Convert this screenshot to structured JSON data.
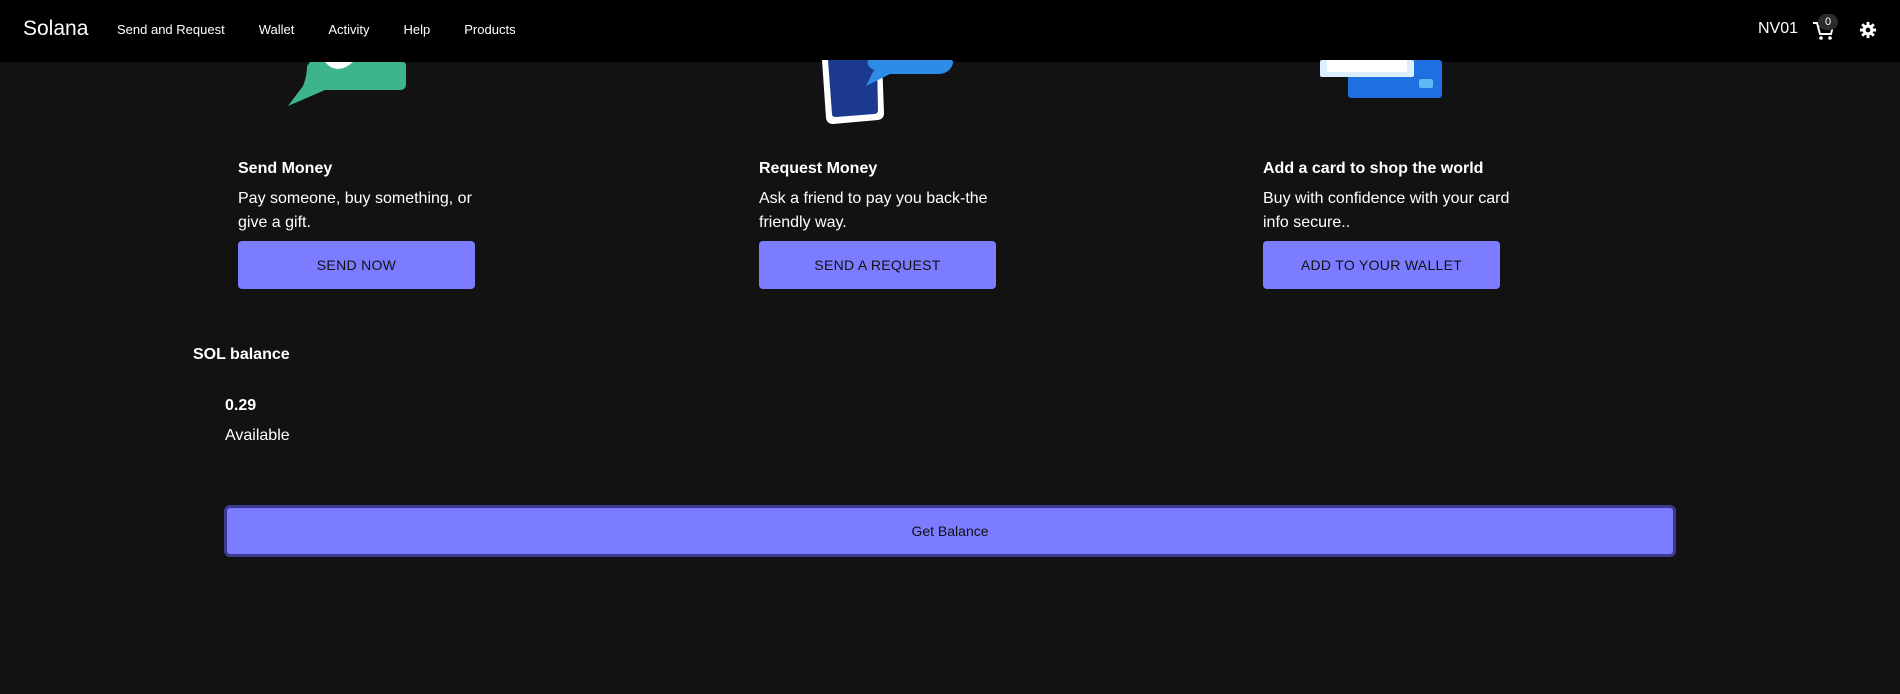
{
  "nav": {
    "brand": "Solana",
    "links": [
      "Send and Request",
      "Wallet",
      "Activity",
      "Help",
      "Products"
    ],
    "user": "NV01",
    "cart_count": "0",
    "cart_icon": "cart-icon",
    "settings_icon": "gear-icon"
  },
  "features": [
    {
      "title": "Send Money",
      "description": "Pay someone, buy something, or give a gift.",
      "button": "SEND NOW",
      "icon": "chat-bubble-illustration"
    },
    {
      "title": "Request Money",
      "description": "Ask a friend to pay you back-the friendly way.",
      "button": "SEND A REQUEST",
      "icon": "phone-illustration"
    },
    {
      "title": "Add a card to shop the world",
      "description": "Buy with confidence with your card info secure..",
      "button": "ADD TO YOUR WALLET",
      "icon": "cards-illustration"
    }
  ],
  "balance": {
    "title": "SOL balance",
    "value": "0.29",
    "label": "Available",
    "button": "Get Balance"
  },
  "colors": {
    "background": "#121212",
    "navbar": "#000000",
    "button": "#7b7cff",
    "green": "#3db48a",
    "blue": "#1e6fe0"
  }
}
